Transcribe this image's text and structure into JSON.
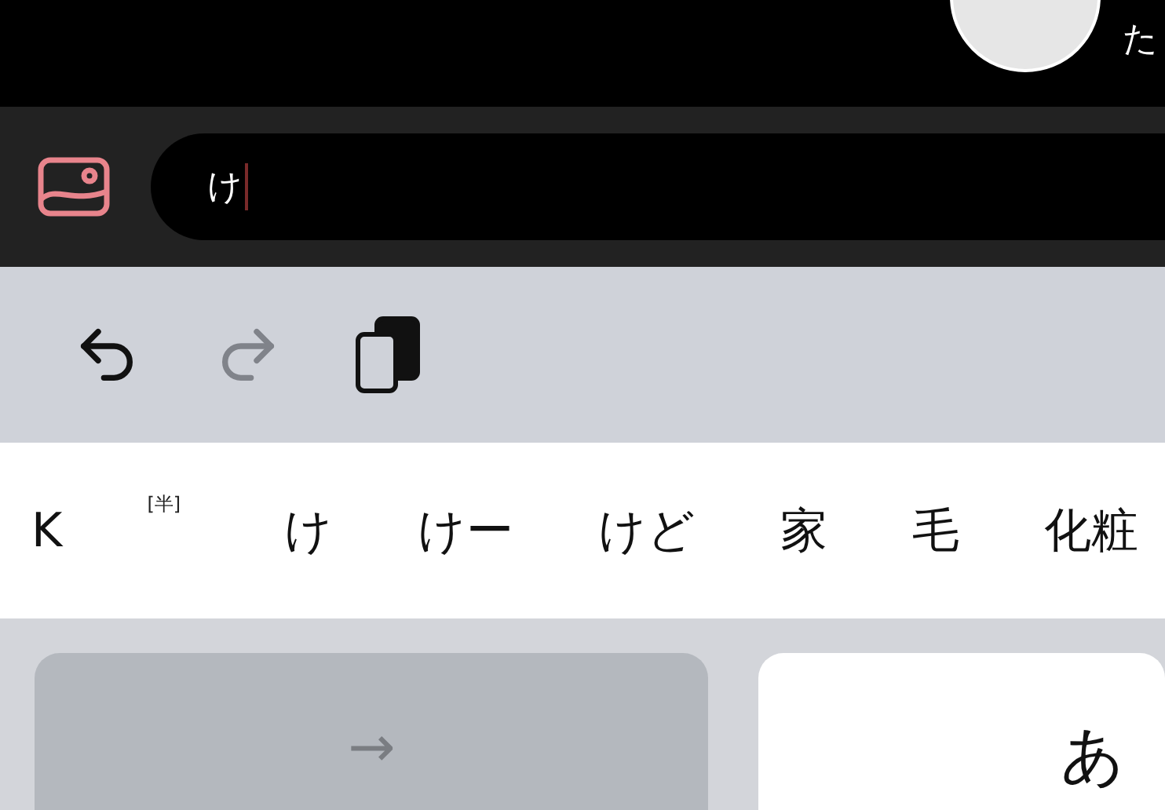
{
  "top_bar": {
    "label": "た"
  },
  "input": {
    "value": "け"
  },
  "toolbar": [
    {
      "kind": "undo",
      "disabled": false
    },
    {
      "kind": "redo",
      "disabled": true
    },
    {
      "kind": "clipboard",
      "disabled": false
    }
  ],
  "candidates": [
    {
      "label": "K",
      "note": "[半]"
    },
    {
      "label": "け"
    },
    {
      "label": "けー"
    },
    {
      "label": "けど"
    },
    {
      "label": "家"
    },
    {
      "label": "毛"
    },
    {
      "label": "化粧"
    }
  ],
  "keys": [
    {
      "kind": "action",
      "label": "→"
    },
    {
      "kind": "char",
      "label": "あ"
    }
  ]
}
